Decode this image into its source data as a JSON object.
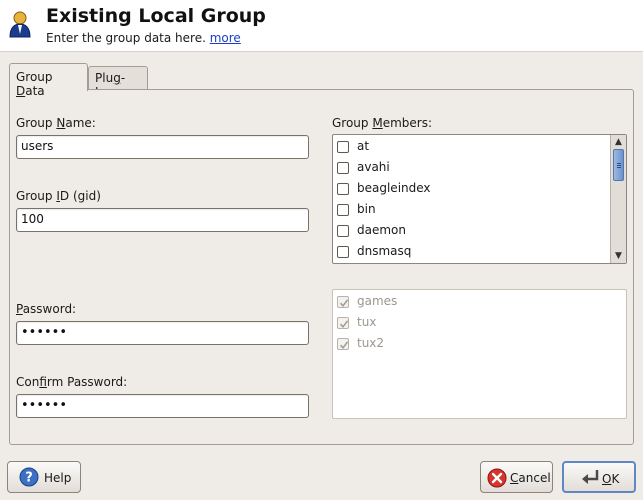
{
  "header": {
    "title": "Existing Local Group",
    "subtitle": "Enter the group data here.",
    "more_link": "more"
  },
  "tabs": [
    {
      "label_pre": "Group ",
      "label_u": "D",
      "label_post": "ata",
      "active": true
    },
    {
      "label_pre": "Plu",
      "label_u": "g",
      "label_post": "-Ins",
      "active": false
    }
  ],
  "form": {
    "group_name": {
      "label_pre": "Group ",
      "label_u": "N",
      "label_post": "ame:",
      "value": "users"
    },
    "group_id": {
      "label_pre": "Group ",
      "label_u": "I",
      "label_post": "D (gid)",
      "value": "100"
    },
    "password": {
      "label_pre": "",
      "label_u": "P",
      "label_post": "assword:",
      "value": "••••••"
    },
    "confirm_password": {
      "label_pre": "Con",
      "label_u": "f",
      "label_post": "irm Password:",
      "value": "••••••"
    }
  },
  "members": {
    "label_pre": "Group ",
    "label_u": "M",
    "label_post": "embers:",
    "items": [
      {
        "name": "at",
        "checked": false
      },
      {
        "name": "avahi",
        "checked": false
      },
      {
        "name": "beagleindex",
        "checked": false
      },
      {
        "name": "bin",
        "checked": false
      },
      {
        "name": "daemon",
        "checked": false
      },
      {
        "name": "dnsmasq",
        "checked": false
      }
    ],
    "fixed_items": [
      {
        "name": "games",
        "checked": true
      },
      {
        "name": "tux",
        "checked": true
      },
      {
        "name": "tux2",
        "checked": true
      }
    ]
  },
  "buttons": {
    "help": {
      "label": "Help"
    },
    "cancel": {
      "label_pre": "",
      "label_u": "C",
      "label_post": "ancel"
    },
    "ok": {
      "label_pre": "",
      "label_u": "O",
      "label_post": "K"
    }
  },
  "colors": {
    "accent": "#5f87c4",
    "scroll_thumb": "#6c92cc",
    "link": "#1a3ec9"
  }
}
